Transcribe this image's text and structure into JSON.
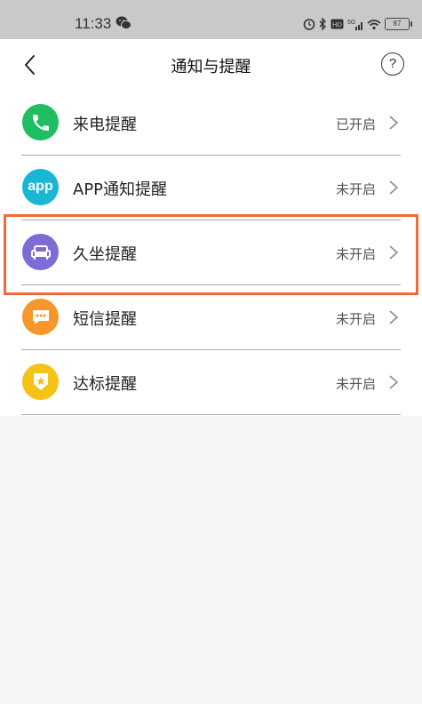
{
  "status_bar": {
    "time": "11:33",
    "battery": "87",
    "network": "5G"
  },
  "nav": {
    "title": "通知与提醒",
    "help_symbol": "?"
  },
  "reminders": [
    {
      "label": "来电提醒",
      "status": "已开启",
      "icon": "phone-icon",
      "color": "#1fbe63"
    },
    {
      "label": "APP通知提醒",
      "status": "未开启",
      "icon": "app-icon",
      "icon_text": "app",
      "color": "#1ab6d6"
    },
    {
      "label": "久坐提醒",
      "status": "未开启",
      "icon": "sofa-icon",
      "color": "#7e6bd6"
    },
    {
      "label": "短信提醒",
      "status": "未开启",
      "icon": "message-icon",
      "color": "#f7962a"
    },
    {
      "label": "达标提醒",
      "status": "未开启",
      "icon": "badge-icon",
      "color": "#f4c316"
    }
  ],
  "colors": {
    "highlight": "#ee6b3d"
  }
}
